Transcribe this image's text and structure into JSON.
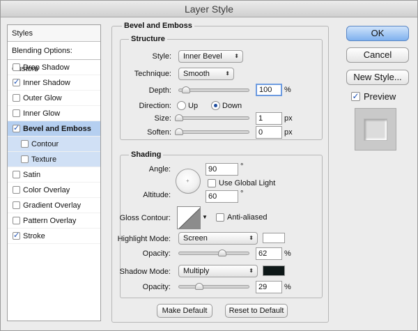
{
  "window": {
    "title": "Layer Style"
  },
  "sidebar": {
    "styles_header": "Styles",
    "blending_options": "Blending Options: Custom",
    "items": [
      {
        "label": "Drop Shadow",
        "checked": false
      },
      {
        "label": "Inner Shadow",
        "checked": true
      },
      {
        "label": "Outer Glow",
        "checked": false
      },
      {
        "label": "Inner Glow",
        "checked": false
      },
      {
        "label": "Bevel and Emboss",
        "checked": true
      },
      {
        "label": "Contour",
        "checked": false
      },
      {
        "label": "Texture",
        "checked": false
      },
      {
        "label": "Satin",
        "checked": false
      },
      {
        "label": "Color Overlay",
        "checked": false
      },
      {
        "label": "Gradient Overlay",
        "checked": false
      },
      {
        "label": "Pattern Overlay",
        "checked": false
      },
      {
        "label": "Stroke",
        "checked": true
      }
    ],
    "check_glyph": "✓"
  },
  "bevel": {
    "title": "Bevel and Emboss",
    "structure": {
      "title": "Structure",
      "style_label": "Style:",
      "style_value": "Inner Bevel",
      "technique_label": "Technique:",
      "technique_value": "Smooth",
      "depth_label": "Depth:",
      "depth_value": "100",
      "depth_unit": "%",
      "depth_fraction": 0.1,
      "direction_label": "Direction:",
      "direction_up": "Up",
      "direction_down": "Down",
      "direction_selected": "Down",
      "size_label": "Size:",
      "size_value": "1",
      "size_unit": "px",
      "size_fraction": 0.0,
      "soften_label": "Soften:",
      "soften_value": "0",
      "soften_unit": "px",
      "soften_fraction": 0.0
    },
    "shading": {
      "title": "Shading",
      "angle_label": "Angle:",
      "angle_value": "90",
      "angle_unit": "°",
      "use_global_light": "Use Global Light",
      "use_global_light_checked": false,
      "altitude_label": "Altitude:",
      "altitude_value": "60",
      "altitude_unit": "°",
      "gloss_contour_label": "Gloss Contour:",
      "anti_aliased": "Anti-aliased",
      "anti_aliased_checked": false,
      "highlight_mode_label": "Highlight Mode:",
      "highlight_mode_value": "Screen",
      "highlight_color": "#ffffff",
      "highlight_opacity_label": "Opacity:",
      "highlight_opacity_value": "62",
      "highlight_opacity_unit": "%",
      "highlight_opacity_fraction": 0.62,
      "shadow_mode_label": "Shadow Mode:",
      "shadow_mode_value": "Multiply",
      "shadow_color": "#0e1818",
      "shadow_opacity_label": "Opacity:",
      "shadow_opacity_value": "29",
      "shadow_opacity_unit": "%",
      "shadow_opacity_fraction": 0.29
    },
    "make_default": "Make Default",
    "reset_default": "Reset to Default"
  },
  "actions": {
    "ok": "OK",
    "cancel": "Cancel",
    "new_style": "New Style...",
    "preview": "Preview",
    "preview_checked": true
  },
  "icons": {
    "popup_arrows": "⬍",
    "contour_arrow": "▼",
    "dial_cross": "+"
  },
  "colors": {
    "selection": "#b5cff0",
    "default_button": "#7fb1ee"
  }
}
